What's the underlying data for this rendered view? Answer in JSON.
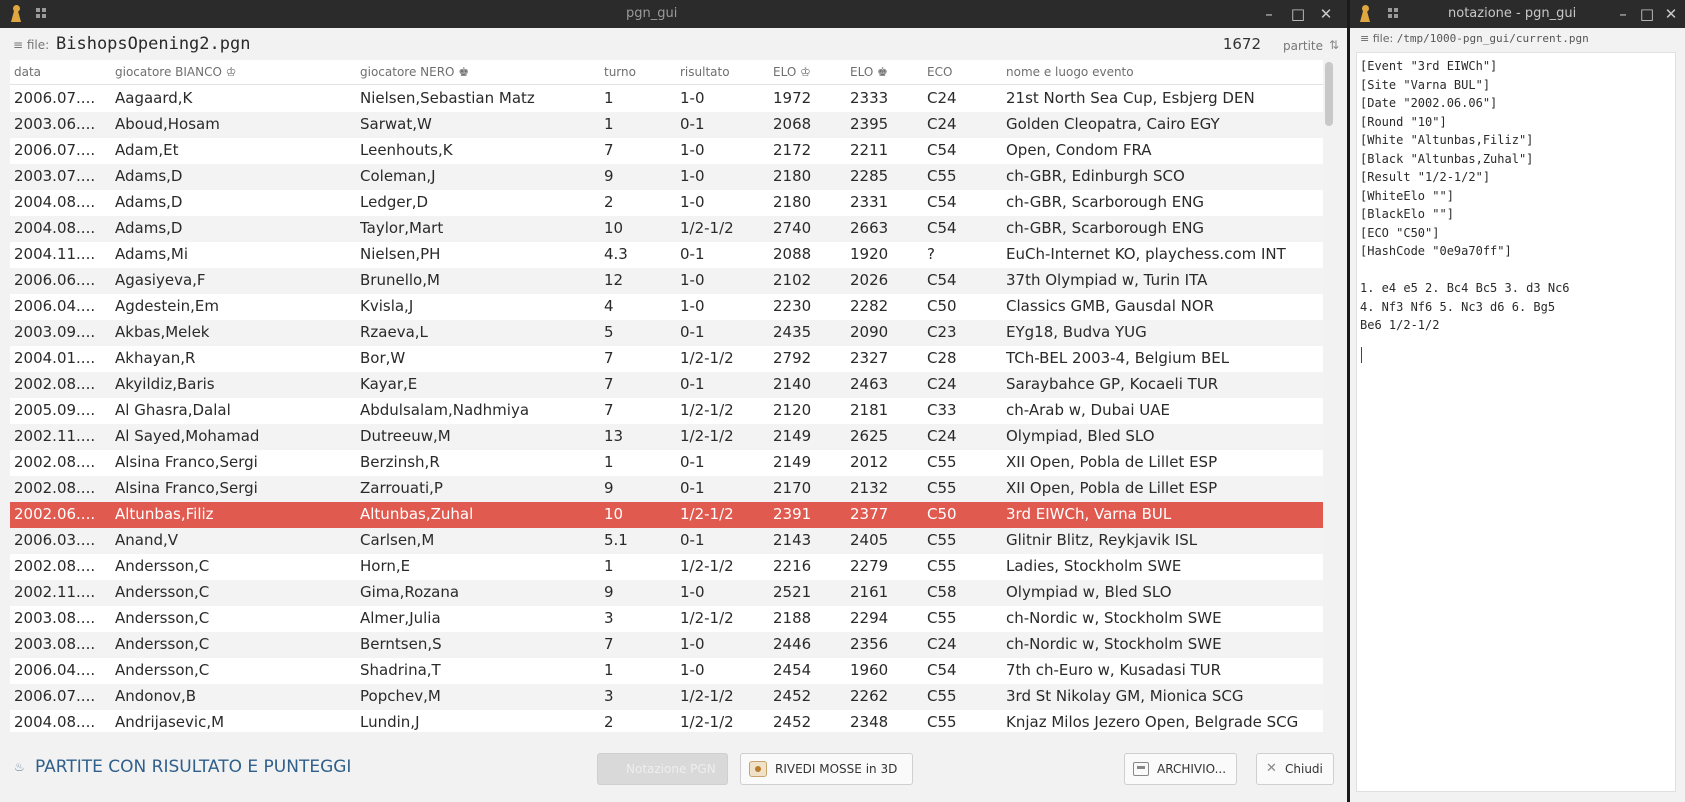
{
  "main_window": {
    "title": "pgn_gui",
    "file_label": "file:",
    "file_name": "BishopsOpening2.pgn",
    "game_count": "1672",
    "count_label": "partite",
    "columns": [
      "data",
      "giocatore BIANCO ♔",
      "giocatore NERO ♚",
      "turno",
      "risultato",
      "ELO ♔",
      "ELO ♚",
      "ECO",
      "nome e luogo evento"
    ],
    "rows": [
      [
        "2006.07....",
        "Aagaard,K",
        "Nielsen,Sebastian Matz",
        "1",
        "1-0",
        "1972",
        "2333",
        "C24",
        "21st North Sea Cup, Esbjerg DEN"
      ],
      [
        "2003.06....",
        "Aboud,Hosam",
        "Sarwat,W",
        "1",
        "0-1",
        "2068",
        "2395",
        "C24",
        "Golden Cleopatra, Cairo EGY"
      ],
      [
        "2006.07....",
        "Adam,Et",
        "Leenhouts,K",
        "7",
        "1-0",
        "2172",
        "2211",
        "C54",
        "Open, Condom FRA"
      ],
      [
        "2003.07....",
        "Adams,D",
        "Coleman,J",
        "9",
        "1-0",
        "2180",
        "2285",
        "C55",
        "ch-GBR, Edinburgh SCO"
      ],
      [
        "2004.08....",
        "Adams,D",
        "Ledger,D",
        "2",
        "1-0",
        "2180",
        "2331",
        "C54",
        "ch-GBR, Scarborough ENG"
      ],
      [
        "2004.08....",
        "Adams,D",
        "Taylor,Mart",
        "10",
        "1/2-1/2",
        "2740",
        "2663",
        "C54",
        "ch-GBR, Scarborough ENG"
      ],
      [
        "2004.11....",
        "Adams,Mi",
        "Nielsen,PH",
        "4.3",
        "0-1",
        "2088",
        "1920",
        "?",
        "EuCh-Internet KO, playchess.com INT"
      ],
      [
        "2006.06....",
        "Agasiyeva,F",
        "Brunello,M",
        "12",
        "1-0",
        "2102",
        "2026",
        "C54",
        "37th Olympiad w, Turin ITA"
      ],
      [
        "2006.04....",
        "Agdestein,Em",
        "Kvisla,J",
        "4",
        "1-0",
        "2230",
        "2282",
        "C50",
        "Classics GMB, Gausdal NOR"
      ],
      [
        "2003.09....",
        "Akbas,Melek",
        "Rzaeva,L",
        "5",
        "0-1",
        "2435",
        "2090",
        "C23",
        "EYg18, Budva YUG"
      ],
      [
        "2004.01....",
        "Akhayan,R",
        "Bor,W",
        "7",
        "1/2-1/2",
        "2792",
        "2327",
        "C28",
        "TCh-BEL 2003-4, Belgium BEL"
      ],
      [
        "2002.08....",
        "Akyildiz,Baris",
        "Kayar,E",
        "7",
        "0-1",
        "2140",
        "2463",
        "C24",
        "Saraybahce GP, Kocaeli TUR"
      ],
      [
        "2005.09....",
        "Al Ghasra,Dalal",
        "Abdulsalam,Nadhmiya",
        "7",
        "1/2-1/2",
        "2120",
        "2181",
        "C33",
        "ch-Arab w, Dubai UAE"
      ],
      [
        "2002.11....",
        "Al Sayed,Mohamad",
        "Dutreeuw,M",
        "13",
        "1/2-1/2",
        "2149",
        "2625",
        "C24",
        "Olympiad, Bled SLO"
      ],
      [
        "2002.08....",
        "Alsina Franco,Sergi",
        "Berzinsh,R",
        "1",
        "0-1",
        "2149",
        "2012",
        "C55",
        "XII Open, Pobla de Lillet ESP"
      ],
      [
        "2002.08....",
        "Alsina Franco,Sergi",
        "Zarrouati,P",
        "9",
        "0-1",
        "2170",
        "2132",
        "C55",
        "XII Open, Pobla de Lillet ESP"
      ],
      [
        "2002.06....",
        "Altunbas,Filiz",
        "Altunbas,Zuhal",
        "10",
        "1/2-1/2",
        "2391",
        "2377",
        "C50",
        "3rd EIWCh, Varna BUL"
      ],
      [
        "2006.03....",
        "Anand,V",
        "Carlsen,M",
        "5.1",
        "0-1",
        "2143",
        "2405",
        "C55",
        "Glitnir Blitz, Reykjavik ISL"
      ],
      [
        "2002.08....",
        "Andersson,C",
        "Horn,E",
        "1",
        "1/2-1/2",
        "2216",
        "2279",
        "C55",
        "Ladies, Stockholm SWE"
      ],
      [
        "2002.11....",
        "Andersson,C",
        "Gima,Rozana",
        "9",
        "1-0",
        "2521",
        "2161",
        "C58",
        "Olympiad w, Bled SLO"
      ],
      [
        "2003.08....",
        "Andersson,C",
        "Almer,Julia",
        "3",
        "1/2-1/2",
        "2188",
        "2294",
        "C55",
        "ch-Nordic w, Stockholm SWE"
      ],
      [
        "2003.08....",
        "Andersson,C",
        "Berntsen,S",
        "7",
        "1-0",
        "2446",
        "2356",
        "C24",
        "ch-Nordic w, Stockholm SWE"
      ],
      [
        "2006.04....",
        "Andersson,C",
        "Shadrina,T",
        "1",
        "1-0",
        "2454",
        "1960",
        "C54",
        "7th ch-Euro w, Kusadasi TUR"
      ],
      [
        "2006.07....",
        "Andonov,B",
        "Popchev,M",
        "3",
        "1/2-1/2",
        "2452",
        "2262",
        "C55",
        "3rd St Nikolay GM, Mionica SCG"
      ],
      [
        "2004.08....",
        "Andrijasevic,M",
        "Lundin,J",
        "2",
        "1/2-1/2",
        "2452",
        "2348",
        "C55",
        "Knjaz Milos Jezero Open, Belgrade SCG"
      ]
    ],
    "selected_row_index": 16,
    "status_text": "PARTITE CON RISULTATO E PUNTEGGI",
    "buttons": {
      "notation": "Notazione PGN",
      "replay": "RIVEDI MOSSE in 3D",
      "archive": "ARCHIVIO...",
      "close": "Chiudi"
    }
  },
  "notes_window": {
    "title": "notazione - pgn_gui",
    "file_label": "file:",
    "file_path": "/tmp/1000-pgn_gui/current.pgn",
    "content": "[Event \"3rd EIWCh\"]\n[Site \"Varna BUL\"]\n[Date \"2002.06.06\"]\n[Round \"10\"]\n[White \"Altunbas,Filiz\"]\n[Black \"Altunbas,Zuhal\"]\n[Result \"1/2-1/2\"]\n[WhiteElo \"\"]\n[BlackElo \"\"]\n[ECO \"C50\"]\n[HashCode \"0e9a70ff\"]\n\n1. e4 e5 2. Bc4 Bc5 3. d3 Nc6\n4. Nf3 Nf6 5. Nc3 d6 6. Bg5\nBe6 1/2-1/2"
  },
  "colors": {
    "selection": "#e05a4f",
    "titlebar": "#2b2b2b",
    "window_bg": "#f2f2f2",
    "status_text": "#2f5f8a"
  },
  "icons": {
    "app": "chess-pawn-icon",
    "menu": "grid-menu-icon",
    "minimize": "minimize-icon",
    "maximize": "maximize-icon",
    "close": "close-icon",
    "file": "file-icon",
    "info": "info-icon",
    "replay": "eye-3d-icon",
    "archive": "archive-box-icon"
  }
}
